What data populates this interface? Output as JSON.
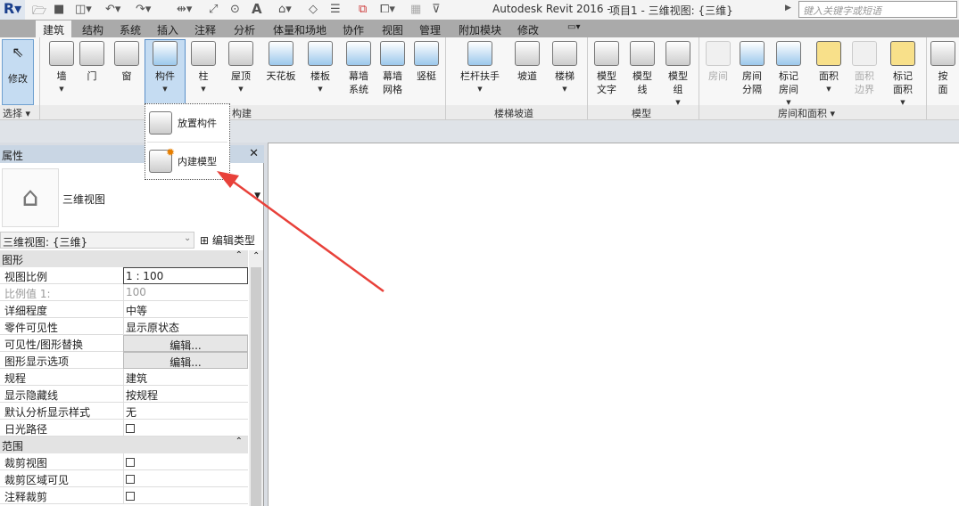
{
  "titlebar": {
    "app_title": "Autodesk Revit 2016 -",
    "doc_title": "项目1 - 三维视图: {三维}",
    "search_placeholder": "键入关键字或短语",
    "quick_access_text_icon": "A"
  },
  "tabs": [
    "建筑",
    "结构",
    "系统",
    "插入",
    "注释",
    "分析",
    "体量和场地",
    "协作",
    "视图",
    "管理",
    "附加模块",
    "修改"
  ],
  "ribbon": {
    "modify": "修改",
    "buttons": [
      {
        "label": "墙"
      },
      {
        "label": "门"
      },
      {
        "label": "窗"
      },
      {
        "label": "构件"
      },
      {
        "label": "柱"
      },
      {
        "label": "屋顶"
      },
      {
        "label": "天花板"
      },
      {
        "label": "楼板"
      },
      {
        "label": "幕墙\n系统"
      },
      {
        "label": "幕墙\n网格"
      },
      {
        "label": "竖梃"
      },
      {
        "label": "栏杆扶手"
      },
      {
        "label": "坡道"
      },
      {
        "label": "楼梯"
      },
      {
        "label": "模型\n文字"
      },
      {
        "label": "模型\n线"
      },
      {
        "label": "模型\n组"
      },
      {
        "label": "房间"
      },
      {
        "label": "房间\n分隔"
      },
      {
        "label": "标记\n房间"
      },
      {
        "label": "面积"
      },
      {
        "label": "面积\n边界"
      },
      {
        "label": "标记\n面积"
      },
      {
        "label": "按\n面"
      }
    ],
    "panels": {
      "select": "选择 ▾",
      "build": "构建",
      "stairs": "楼梯坡道",
      "model": "模型",
      "rooms": "房间和面积 ▾"
    }
  },
  "dropdown_menu": {
    "items": [
      "放置构件",
      "内建模型"
    ]
  },
  "properties": {
    "title": "属性",
    "close": "✕",
    "view_type": "三维视图",
    "selector": "三维视图: {三维}",
    "edit_type": "编辑类型",
    "groups": [
      {
        "name": "图形",
        "rows": [
          {
            "key": "视图比例",
            "value": "1 : 100"
          },
          {
            "key": "比例值 1:",
            "value": "100"
          },
          {
            "key": "详细程度",
            "value": "中等"
          },
          {
            "key": "零件可见性",
            "value": "显示原状态"
          },
          {
            "key": "可见性/图形替换",
            "value": "编辑..."
          },
          {
            "key": "图形显示选项",
            "value": "编辑..."
          },
          {
            "key": "规程",
            "value": "建筑"
          },
          {
            "key": "显示隐藏线",
            "value": "按规程"
          },
          {
            "key": "默认分析显示样式",
            "value": "无"
          },
          {
            "key": "日光路径",
            "value": ""
          }
        ]
      },
      {
        "name": "范围",
        "rows": [
          {
            "key": "裁剪视图",
            "value": ""
          },
          {
            "key": "裁剪区域可见",
            "value": ""
          },
          {
            "key": "注释裁剪",
            "value": ""
          }
        ]
      }
    ]
  },
  "colors": {
    "accent": "#c5dcf2",
    "annotation_arrow": "#e8413a"
  }
}
